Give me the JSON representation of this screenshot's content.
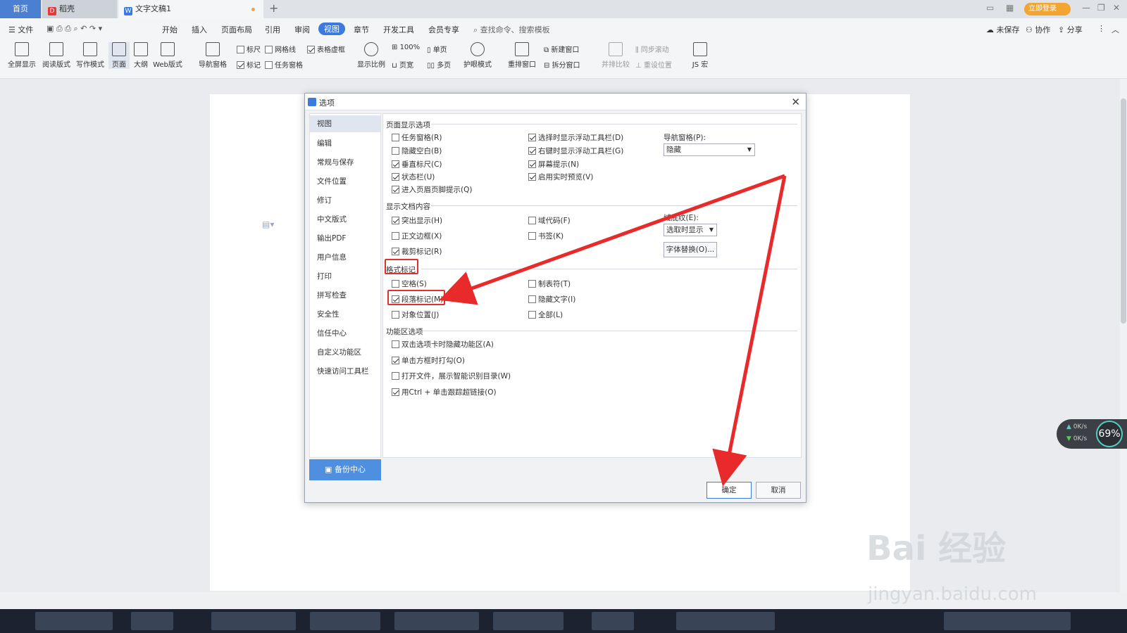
{
  "tabs": {
    "home": "首页",
    "daoke": "稻壳",
    "doc": "文字文稿1",
    "plus": "+"
  },
  "titlebar": {
    "login": "立即登录"
  },
  "menubar": {
    "file": "文件",
    "items": [
      "开始",
      "插入",
      "页面布局",
      "引用",
      "审阅",
      "视图",
      "章节",
      "开发工具",
      "会员专享"
    ],
    "search": "查找命令、搜索模板",
    "unsaved": "未保存",
    "collab": "协作",
    "share": "分享"
  },
  "ribbon": {
    "fullscreen": "全屏显示",
    "read": "阅读版式",
    "write": "写作模式",
    "page": "页面",
    "outline": "大纲",
    "web": "Web版式",
    "navpane": "导航窗格",
    "ruler": "标尺",
    "grid": "网格线",
    "tablegrid": "表格虚框",
    "mark": "标记",
    "taskpane": "任务窗格",
    "zoom": "显示比例",
    "zoom100": "100%",
    "single": "单页",
    "pagewidth": "页宽",
    "multi": "多页",
    "eyecare": "护眼模式",
    "rearrange": "重排窗口",
    "newwin": "新建窗口",
    "split": "拆分窗口",
    "compare": "并排比较",
    "syncscroll": "同步滚动",
    "resetpos": "重设位置",
    "js": "JS 宏"
  },
  "dialog": {
    "title": "选项",
    "nav": [
      "视图",
      "编辑",
      "常规与保存",
      "文件位置",
      "修订",
      "中文版式",
      "输出PDF",
      "用户信息",
      "打印",
      "拼写检查",
      "安全性",
      "信任中心",
      "自定义功能区",
      "快速访问工具栏"
    ],
    "backup": "备份中心",
    "sec_page": "页面显示选项",
    "sec_doc": "显示文档内容",
    "sec_format": "格式标记",
    "sec_func": "功能区选项",
    "opt": {
      "taskpane": "任务窗格(R)",
      "floatbar": "选择时显示浮动工具栏(D)",
      "hideblank": "隐藏空白(B)",
      "rightbar": "右键时显示浮动工具栏(G)",
      "vruler": "垂直标尺(C)",
      "screentip": "屏幕提示(N)",
      "statusbar": "状态栏(U)",
      "livepreview": "启用实时预览(V)",
      "headertip": "进入页眉页脚提示(Q)",
      "highlight": "突出显示(H)",
      "fieldcode": "域代码(F)",
      "textborder": "正文边框(X)",
      "bookmark": "书签(K)",
      "cropmark": "裁剪标记(R)",
      "space": "空格(S)",
      "tab": "制表符(T)",
      "paramark": "段落标记(M)",
      "hiddentext": "隐藏文字(I)",
      "objpos": "对象位置(J)",
      "all": "全部(L)",
      "dblhide": "双击选项卡时隐藏功能区(A)",
      "singlecheck": "单击方框时打勾(O)",
      "smartcat": "打开文件，展示智能识别目录(W)",
      "ctrlclick": "用Ctrl + 单击跟踪超链接(O)"
    },
    "navpane_label": "导航窗格(P):",
    "navpane_value": "隐藏",
    "field_label": "域底纹(E):",
    "field_value": "选取时显示",
    "fontsub": "字体替换(O)...",
    "ok": "确定",
    "cancel": "取消"
  },
  "speed": {
    "up": "0K/s",
    "down": "0K/s",
    "pct": "69%"
  },
  "watermark": {
    "brand": "Bai 经验",
    "url": "jingyan.baidu.com"
  }
}
